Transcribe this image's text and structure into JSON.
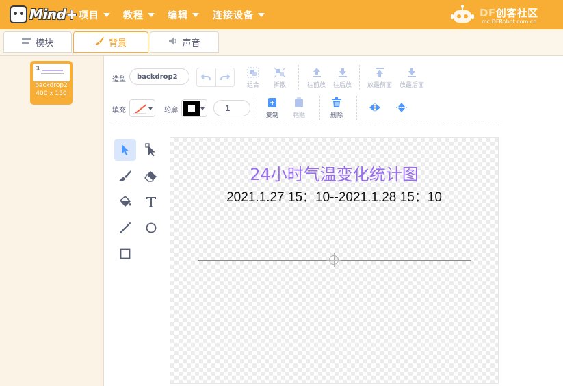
{
  "menubar": {
    "logo_text": "Mind+",
    "items": [
      {
        "label": "项目"
      },
      {
        "label": "教程"
      },
      {
        "label": "编辑"
      },
      {
        "label": "连接设备"
      }
    ],
    "brand_title_prefix": "DF",
    "brand_title_rest": "创客社区",
    "brand_subtitle": "mc.DFRobot.com.cn",
    "bg_color": "#f8ae34"
  },
  "tabs": [
    {
      "label": "模块",
      "icon": "blocks-icon",
      "active": false
    },
    {
      "label": "背景",
      "icon": "brush-icon",
      "active": true
    },
    {
      "label": "声音",
      "icon": "speaker-icon",
      "active": false
    }
  ],
  "costumes": [
    {
      "number": "1",
      "name": "backdrop2",
      "size": "400 x 150",
      "selected": true
    }
  ],
  "toolbar": {
    "costume_label": "造型",
    "costume_name": "backdrop2",
    "group_label": "组合",
    "ungroup_label": "拆散",
    "forward_label": "往前放",
    "backward_label": "往后放",
    "front_label": "放最前面",
    "back_label": "放最后面",
    "fill_label": "填充",
    "outline_label": "轮廓",
    "outline_width": "1",
    "copy_label": "复制",
    "paste_label": "粘贴",
    "delete_label": "删除"
  },
  "canvas": {
    "title": "24小时气温变化统计图",
    "subtitle": "2021.1.27 15：10--2021.1.28 15：10",
    "title_color": "#9a6df0"
  }
}
